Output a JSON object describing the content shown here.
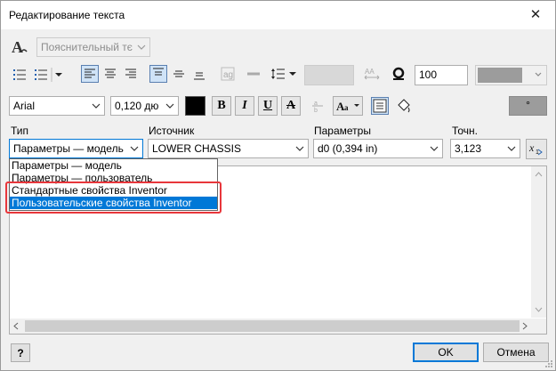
{
  "window": {
    "title": "Редактирование текста",
    "close_glyph": "✕"
  },
  "toolbar1": {
    "style_value": "Пояснительный тє",
    "line_spacing_value": "",
    "width_scale": "100",
    "color_value": ""
  },
  "toolbar2": {
    "font": "Arial",
    "size": "0,120 дю",
    "bold": "B",
    "italic": "I",
    "underline": "U",
    "strike": "A",
    "point_glyph": "°"
  },
  "params_row": {
    "type_label": "Тип",
    "type_value": "Параметры — модель",
    "source_label": "Источник",
    "source_value": "LOWER CHASSIS",
    "params_label": "Параметры",
    "params_value": "d0 (0,394 in)",
    "precision_label": "Точн.",
    "precision_value": "3,123",
    "insert_icon": "x1"
  },
  "type_dropdown": {
    "options": [
      "Параметры — модель",
      "Параметры — пользователь",
      "Стандартные свойства Inventor",
      "Пользовательские свойства Inventor"
    ],
    "highlighted_index": 3
  },
  "footer": {
    "help": "?",
    "ok": "OK",
    "cancel": "Отмена"
  },
  "colors": {
    "accent": "#0078d7",
    "highlight_box": "#e8363b",
    "selected_tool": "#cfe3f7"
  }
}
